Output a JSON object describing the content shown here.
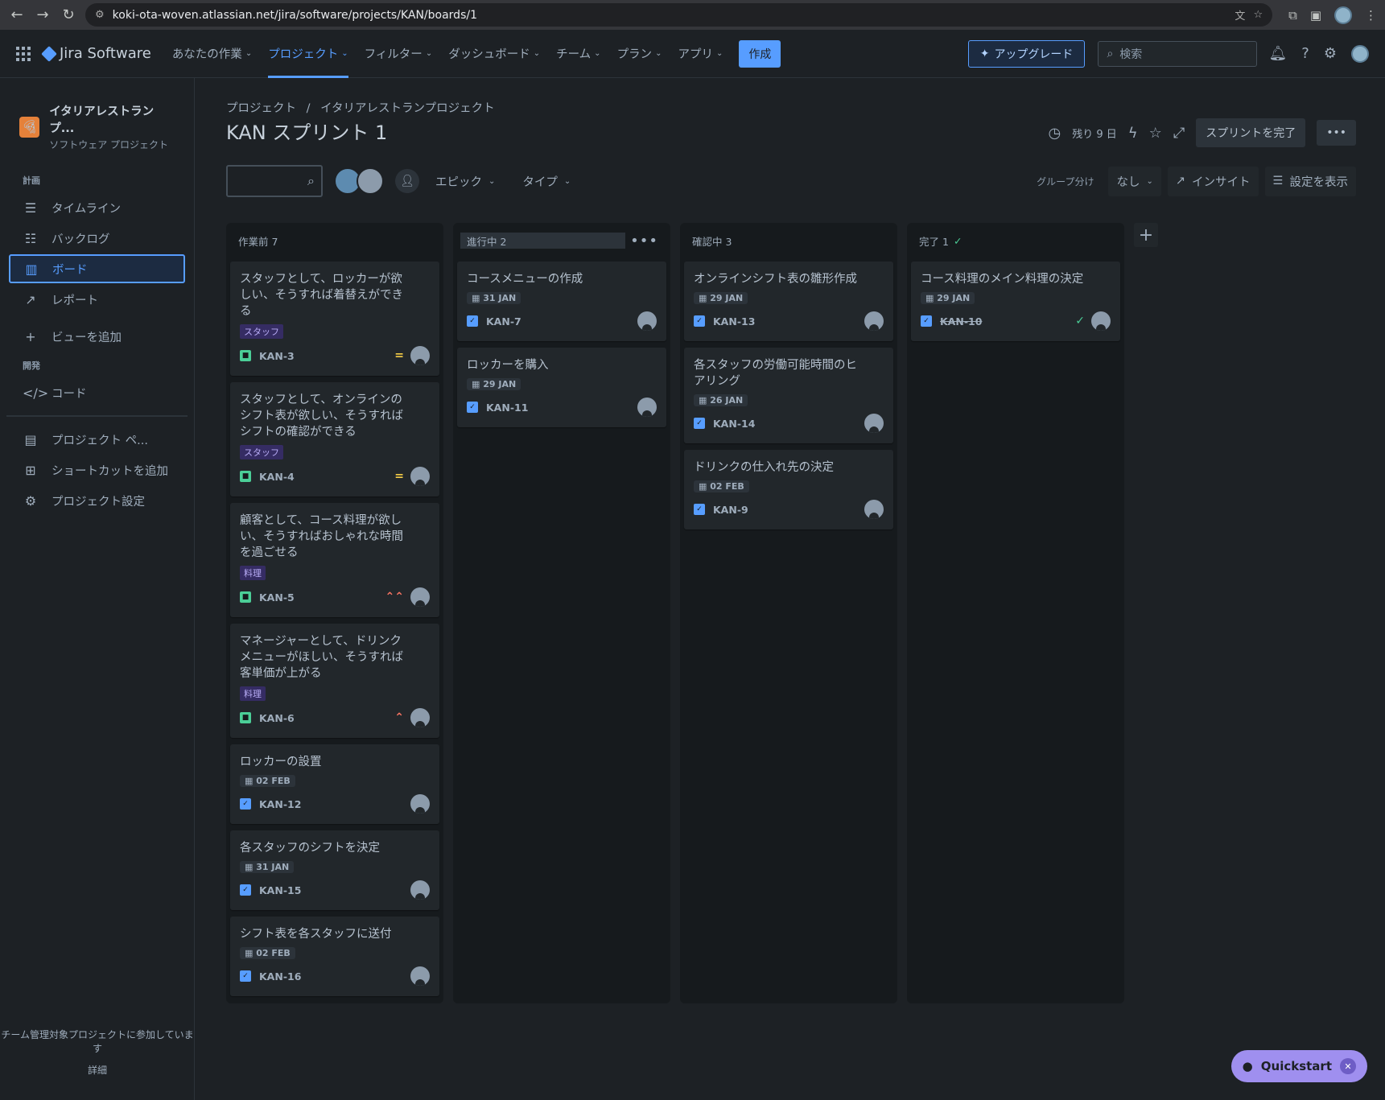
{
  "browser": {
    "url": "koki-ota-woven.atlassian.net/jira/software/projects/KAN/boards/1"
  },
  "nav": {
    "product": "Jira Software",
    "items": [
      {
        "label": "あなたの作業"
      },
      {
        "label": "プロジェクト"
      },
      {
        "label": "フィルター"
      },
      {
        "label": "ダッシュボード"
      },
      {
        "label": "チーム"
      },
      {
        "label": "プラン"
      },
      {
        "label": "アプリ"
      }
    ],
    "create": "作成",
    "upgrade": "アップグレード",
    "search_placeholder": "検索"
  },
  "sidebar": {
    "project_name": "イタリアレストランプ...",
    "project_type": "ソフトウェア プロジェクト",
    "section_plan": "計画",
    "plan_items": [
      {
        "label": "タイムライン"
      },
      {
        "label": "バックログ"
      },
      {
        "label": "ボード"
      },
      {
        "label": "レポート"
      },
      {
        "label": "ビューを追加"
      }
    ],
    "section_dev": "開発",
    "dev_items": [
      {
        "label": "コード"
      }
    ],
    "other_items": [
      {
        "label": "プロジェクト ペ..."
      },
      {
        "label": "ショートカットを追加"
      },
      {
        "label": "プロジェクト設定"
      }
    ],
    "footer_text": "チーム管理対象プロジェクトに参加しています",
    "footer_link": "詳細"
  },
  "header": {
    "breadcrumb": [
      "プロジェクト",
      "イタリアレストランプロジェクト"
    ],
    "breadcrumb_sep": "/",
    "title": "KAN スプリント 1",
    "remaining": "残り 9 日",
    "complete_sprint": "スプリントを完了"
  },
  "toolbar": {
    "epic": "エピック",
    "type": "タイプ",
    "group_by_label": "グループ分け",
    "group_by_value": "なし",
    "insight": "インサイト",
    "view_settings": "設定を表示"
  },
  "columns": [
    {
      "title": "作業前 7",
      "cards": [
        {
          "title": "スタッフとして、ロッカーが欲しい、そうすれば着替えができる",
          "label": "スタッフ",
          "key": "KAN-3",
          "type": "story",
          "priority": "medium"
        },
        {
          "title": "スタッフとして、オンラインのシフト表が欲しい、そうすればシフトの確認ができる",
          "label": "スタッフ",
          "key": "KAN-4",
          "type": "story",
          "priority": "medium"
        },
        {
          "title": "顧客として、コース料理が欲しい、そうすればおしゃれな時間を過ごせる",
          "label": "料理",
          "key": "KAN-5",
          "type": "story",
          "priority": "highest"
        },
        {
          "title": "マネージャーとして、ドリンクメニューがほしい、そうすれば客単価が上がる",
          "label": "料理",
          "key": "KAN-6",
          "type": "story",
          "priority": "high"
        },
        {
          "title": "ロッカーの設置",
          "date": "02 FEB",
          "key": "KAN-12",
          "type": "task"
        },
        {
          "title": "各スタッフのシフトを決定",
          "date": "31 JAN",
          "key": "KAN-15",
          "type": "task"
        },
        {
          "title": "シフト表を各スタッフに送付",
          "date": "02 FEB",
          "key": "KAN-16",
          "type": "task"
        }
      ]
    },
    {
      "title": "進行中 2",
      "cards": [
        {
          "title": "コースメニューの作成",
          "date": "31 JAN",
          "key": "KAN-7",
          "type": "task"
        },
        {
          "title": "ロッカーを購入",
          "date": "29 JAN",
          "key": "KAN-11",
          "type": "task"
        }
      ]
    },
    {
      "title": "確認中 3",
      "cards": [
        {
          "title": "オンラインシフト表の雛形作成",
          "date": "29 JAN",
          "key": "KAN-13",
          "type": "task"
        },
        {
          "title": "各スタッフの労働可能時間のヒアリング",
          "date": "26 JAN",
          "key": "KAN-14",
          "type": "task"
        },
        {
          "title": "ドリンクの仕入れ先の決定",
          "date": "02 FEB",
          "key": "KAN-9",
          "type": "task"
        }
      ]
    },
    {
      "title": "完了 1",
      "cards": [
        {
          "title": "コース料理のメイン料理の決定",
          "date": "29 JAN",
          "key": "KAN-10",
          "type": "task",
          "done": true
        }
      ]
    }
  ],
  "quickstart": "Quickstart",
  "colors": {
    "accent": "#579dff",
    "story": "#4bce97",
    "label_bg": "#352c63",
    "quickstart": "#9f8fef"
  }
}
